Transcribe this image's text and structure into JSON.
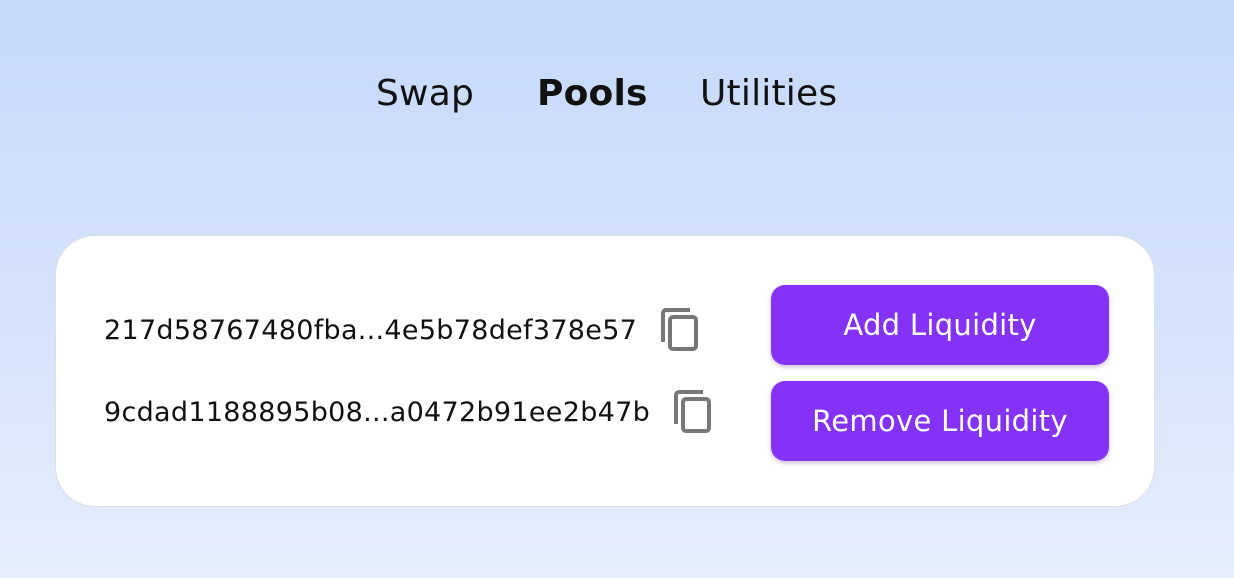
{
  "nav": {
    "items": [
      {
        "label": "Swap",
        "active": false
      },
      {
        "label": "Pools",
        "active": true
      },
      {
        "label": "Utilities",
        "active": false
      }
    ]
  },
  "pools": [
    {
      "address": "217d58767480fba...4e5b78def378e57",
      "copy_icon": "copy-icon"
    },
    {
      "address": "9cdad1188895b08...a0472b91ee2b47b",
      "copy_icon": "copy-icon"
    }
  ],
  "actions": {
    "add_label": "Add Liquidity",
    "remove_label": "Remove Liquidity"
  },
  "colors": {
    "accent": "#8432f6",
    "background_top": "#c6d9fb",
    "background_bottom": "#e6eefd",
    "card": "#ffffff",
    "icon": "#777777"
  }
}
